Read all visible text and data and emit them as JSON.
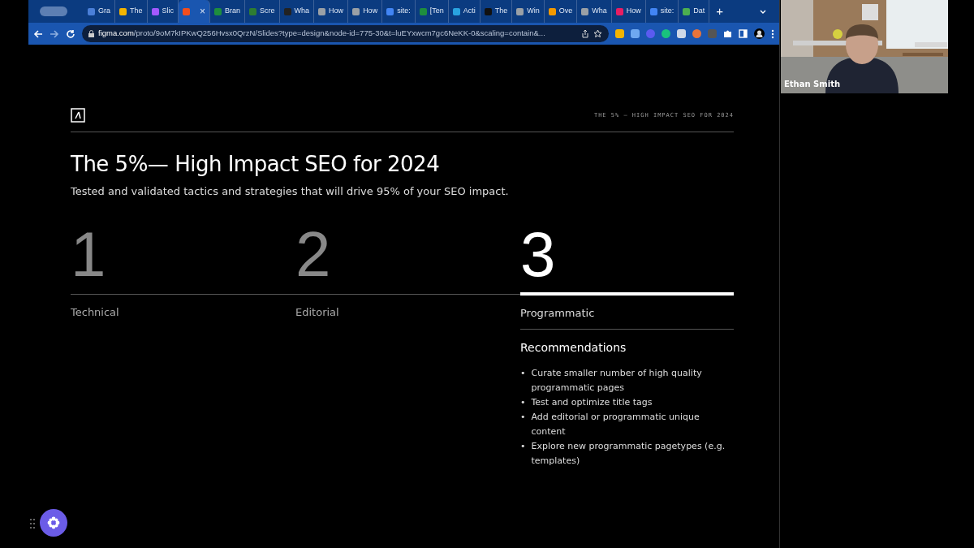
{
  "browser": {
    "tabs": [
      {
        "label": "Gra",
        "color": "#4a7fd8",
        "selected": false
      },
      {
        "label": "The",
        "color": "#f2b400",
        "selected": false
      },
      {
        "label": "Slic",
        "color": "#a259ff",
        "selected": false
      },
      {
        "color": "#f24e1e",
        "selected": true,
        "close": "×"
      },
      {
        "label": "Bran",
        "color": "#1e8e3e",
        "selected": false
      },
      {
        "label": "Scre",
        "color": "#2e7d32",
        "selected": false
      },
      {
        "label": "Wha",
        "color": "#222222",
        "selected": false
      },
      {
        "label": "How",
        "color": "#9aa0a6",
        "selected": false
      },
      {
        "label": "How",
        "color": "#9aa0a6",
        "selected": false
      },
      {
        "label": "site:",
        "color": "#4285f4",
        "selected": false
      },
      {
        "label": "[Ten",
        "color": "#1e8e3e",
        "selected": false
      },
      {
        "label": "Acti",
        "color": "#29a3e0",
        "selected": false
      },
      {
        "label": "The",
        "color": "#111111",
        "selected": false
      },
      {
        "label": "Win",
        "color": "#9aa0a6",
        "selected": false
      },
      {
        "label": "Ove",
        "color": "#f29900",
        "selected": false
      },
      {
        "label": "Wha",
        "color": "#9aa0a6",
        "selected": false
      },
      {
        "label": "How",
        "color": "#e91e63",
        "selected": false
      },
      {
        "label": "site:",
        "color": "#4285f4",
        "selected": false
      },
      {
        "label": "Dat",
        "color": "#4caf50",
        "selected": false
      }
    ],
    "new_tab": "+",
    "url_domain": "figma.com",
    "url_path": "/proto/9oM7kIPKwQ256Hvsx0QrzN/Slides?type=design&node-id=775-30&t=luEYxwcm7gc6NeKK-0&scaling=contain&..."
  },
  "slide": {
    "header_caption": "THE 5% — HIGH IMPACT SEO FOR 2024",
    "title": "The 5%— High Impact SEO for 2024",
    "subtitle": "Tested and validated tactics and strategies that will drive 95% of your SEO impact.",
    "steps": [
      {
        "number": "1",
        "label": "Technical",
        "selected": false
      },
      {
        "number": "2",
        "label": "Editorial",
        "selected": false
      },
      {
        "number": "3",
        "label": "Programmatic",
        "selected": true
      }
    ],
    "recommendations": {
      "heading": "Recommendations",
      "bullet": "•",
      "items": [
        "Curate smaller number of high quality programmatic pages",
        "Test and optimize title tags",
        "Add editorial or programmatic unique content",
        "Explore new programmatic pagetypes (e.g. templates)"
      ]
    }
  },
  "video": {
    "participant": "Ethan Smith"
  }
}
